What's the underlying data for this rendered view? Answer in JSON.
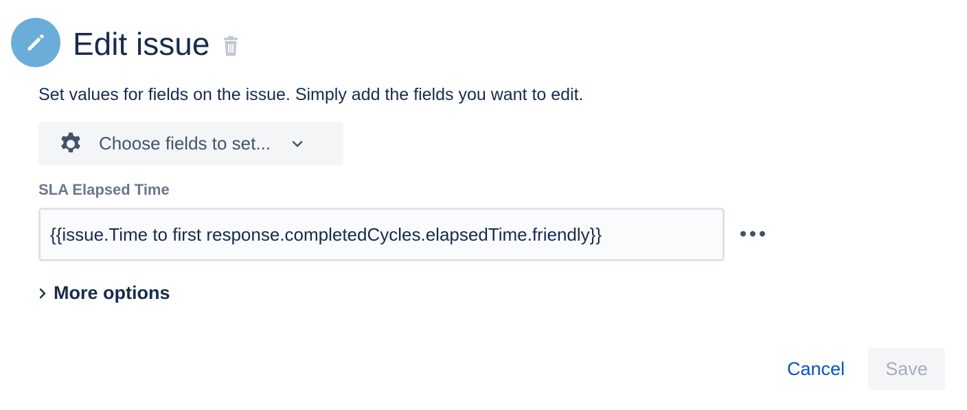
{
  "header": {
    "title": "Edit issue",
    "icon": "pencil-icon",
    "delete_icon": "trash-icon",
    "accent_color": "#6badd9"
  },
  "description": "Set values for fields on the issue. Simply add the fields you want to edit.",
  "field_chooser": {
    "label": "Choose fields to set...",
    "icon": "gear-icon",
    "dropdown_icon": "chevron-down-icon"
  },
  "fields": [
    {
      "label": "SLA Elapsed Time",
      "value": "{{issue.Time to first response.completedCycles.elapsedTime.friendly}}",
      "actions_icon": "more-horizontal-icon"
    }
  ],
  "more_options": {
    "label": "More options",
    "icon": "chevron-right-icon"
  },
  "footer": {
    "cancel_label": "Cancel",
    "save_label": "Save",
    "link_color": "#0052cc"
  }
}
